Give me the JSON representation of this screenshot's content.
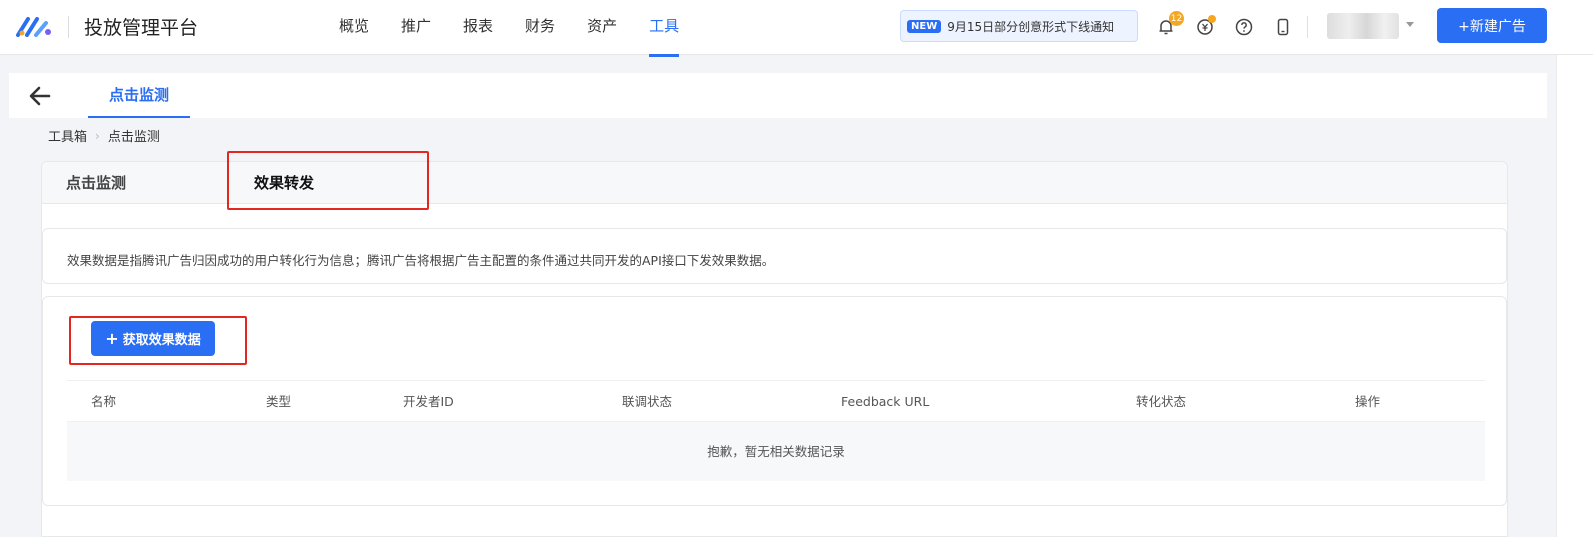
{
  "header": {
    "app_title": "投放管理平台",
    "nav": [
      {
        "label": "概览",
        "active": false
      },
      {
        "label": "推广",
        "active": false
      },
      {
        "label": "报表",
        "active": false
      },
      {
        "label": "财务",
        "active": false
      },
      {
        "label": "资产",
        "active": false
      },
      {
        "label": "工具",
        "active": true
      }
    ],
    "notice": {
      "badge": "NEW",
      "text": "9月15日部分创意形式下线通知"
    },
    "notification_count": "12",
    "icons": [
      "logo-icon",
      "bell-icon",
      "coin-icon",
      "help-icon",
      "phone-icon",
      "chevron-down-icon"
    ],
    "new_ad_button": "+新建广告",
    "accent_color": "#2a6ef4"
  },
  "subheader": {
    "tab": "点击监测"
  },
  "breadcrumb": [
    "工具箱",
    "点击监测"
  ],
  "card": {
    "tabs": [
      {
        "label": "点击监测",
        "active": false
      },
      {
        "label": "效果转发",
        "active": true
      }
    ],
    "description": "效果数据是指腾讯广告归因成功的用户转化行为信息；腾讯广告将根据广告主配置的条件通过共同开发的API接口下发效果数据。",
    "get_data_button": "获取效果数据",
    "table": {
      "columns": [
        "名称",
        "类型",
        "开发者ID",
        "联调状态",
        "Feedback URL",
        "转化状态",
        "操作"
      ],
      "rows": [],
      "empty_text": "抱歉，暂无相关数据记录"
    }
  },
  "highlight_color": "#e3261f"
}
